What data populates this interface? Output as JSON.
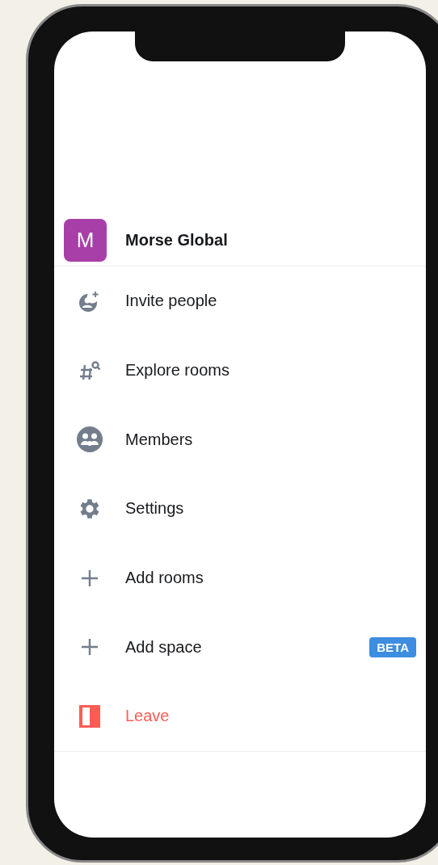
{
  "space": {
    "avatar_letter": "M",
    "name": "Morse Global"
  },
  "menu": [
    {
      "label": "Invite people",
      "kind": "normal"
    },
    {
      "label": "Explore rooms",
      "kind": "normal"
    },
    {
      "label": "Members",
      "kind": "normal"
    },
    {
      "label": "Settings",
      "kind": "normal"
    },
    {
      "label": "Add rooms",
      "kind": "normal"
    },
    {
      "label": "Add space",
      "kind": "normal",
      "badge": "BETA"
    },
    {
      "label": "Leave",
      "kind": "danger"
    }
  ]
}
